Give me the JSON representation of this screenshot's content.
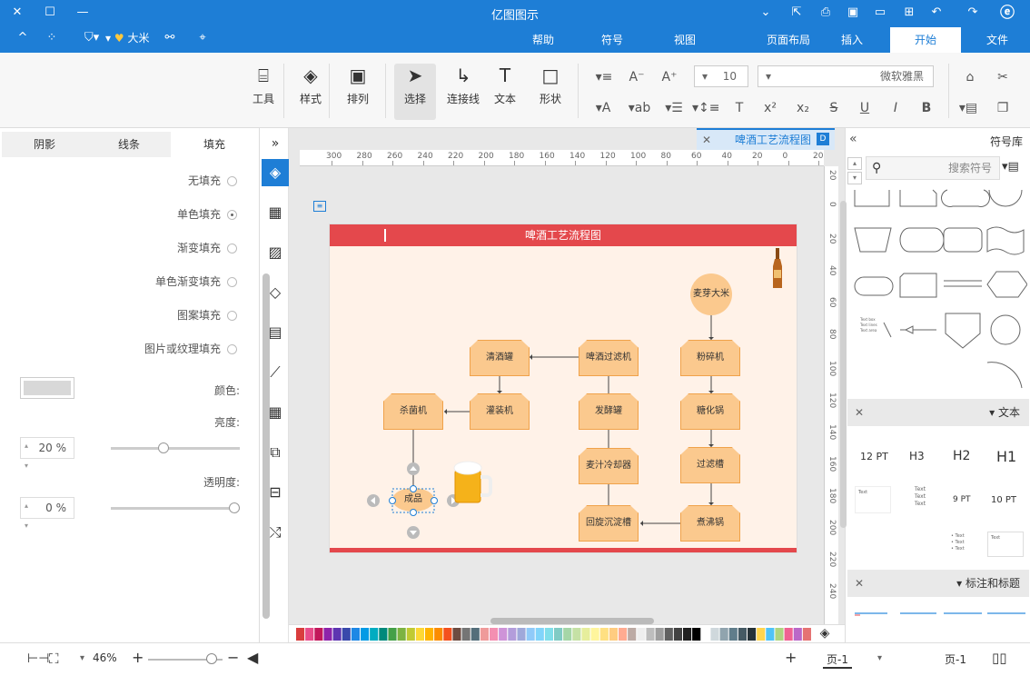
{
  "app": {
    "title": "亿图图示"
  },
  "titlebar": {
    "user_name": "大米",
    "menu_arrow": "▾"
  },
  "tabs": {
    "file": "文件",
    "home": "开始",
    "insert": "插入",
    "page_layout": "页面布局",
    "view": "视图",
    "symbols": "符号",
    "help": "帮助"
  },
  "ribbon": {
    "font_name": "微软雅黑",
    "font_size": "10",
    "tools": {
      "shape": "形状",
      "text": "文本",
      "connector": "连接线",
      "select": "选择",
      "arrange": "排列",
      "style": "样式",
      "tools": "工具"
    }
  },
  "left_panel": {
    "tabs": {
      "fill": "填充",
      "line": "线条",
      "shadow": "阴影"
    },
    "options": [
      "无填充",
      "单色填充",
      "渐变填充",
      "单色渐变填充",
      "图案填充",
      "图片或纹理填充"
    ],
    "color_label": "颜色:",
    "brightness_label": "亮度:",
    "brightness_value": "20 %",
    "transparency_label": "透明度:",
    "transparency_value": "0 %"
  },
  "document": {
    "tab_label": "啤酒工艺流程图"
  },
  "ruler": {
    "h_ticks": [
      "20",
      "0",
      "20",
      "40",
      "60",
      "80",
      "100",
      "120",
      "140",
      "160",
      "180",
      "200",
      "220",
      "240",
      "260",
      "280",
      "300"
    ],
    "v_ticks": [
      "20",
      "0",
      "20",
      "40",
      "60",
      "80",
      "100",
      "120",
      "140",
      "160",
      "180",
      "200",
      "220",
      "240"
    ]
  },
  "diagram": {
    "title": "啤酒工艺流程图",
    "nodes": {
      "rice": "麦芽大米",
      "crusher": "粉碎机",
      "saccharifier": "糖化锅",
      "filter_tank": "过滤槽",
      "boil_pot": "煮沸锅",
      "whirlpool": "回旋沉淀槽",
      "wort_cooler": "麦汁冷却器",
      "fermenter": "发酵罐",
      "beer_filter": "啤酒过滤机",
      "clear_tank": "清酒罐",
      "bottler": "灌装机",
      "sterilizer": "杀菌机",
      "beer": "成品"
    }
  },
  "status": {
    "page_selector": "页-1",
    "page_tab": "页-1",
    "add_page": "+",
    "zoom": "46%"
  },
  "right_panel": {
    "title": "符号库",
    "search_placeholder": "搜索符号",
    "text_section": "文本",
    "headings": [
      "H1",
      "H2",
      "H3",
      "12 PT"
    ],
    "sizes": [
      "10 PT",
      "9 PT"
    ],
    "text_samples": [
      "Text",
      "Text",
      "Text"
    ],
    "callout_section": "标注和标题"
  },
  "colors": {
    "accent": "#1e7ed6",
    "header_red": "#e4484c",
    "node_fill": "#fbc98e",
    "page_bg": "#fff2e8"
  }
}
